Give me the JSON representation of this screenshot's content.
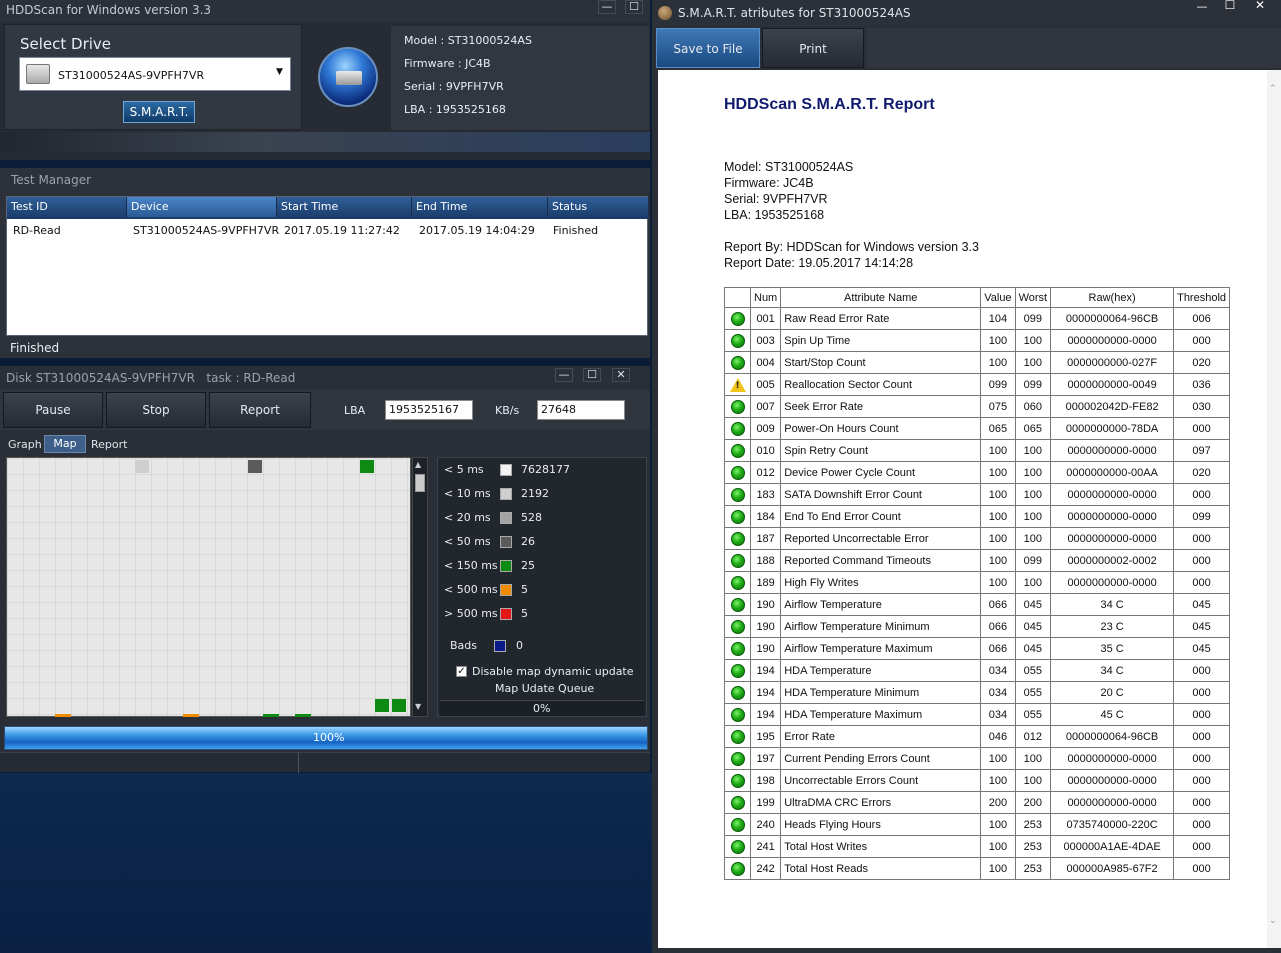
{
  "main_window": {
    "title": "HDDScan for Windows version 3.3",
    "select_drive_label": "Select Drive",
    "drive": "ST31000524AS-9VPFH7VR",
    "smart_button": "S.M.A.R.T.",
    "info": {
      "model": "Model : ST31000524AS",
      "firmware": "Firmware : JC4B",
      "serial": "Serial : 9VPFH7VR",
      "lba": "LBA : 1953525168"
    }
  },
  "test_manager": {
    "title": "Test Manager",
    "columns": [
      "Test ID",
      "Device",
      "Start Time",
      "End Time",
      "Status"
    ],
    "rows": [
      [
        "RD-Read",
        "ST31000524AS-9VPFH7VR",
        "2017.05.19 11:27:42",
        "2017.05.19 14:04:29",
        "Finished"
      ]
    ],
    "status": "Finished"
  },
  "task_window": {
    "title": "Disk ST31000524AS-9VPFH7VR   task : RD-Read",
    "buttons": [
      "Pause",
      "Stop",
      "Report"
    ],
    "lba_label": "LBA",
    "lba_value": "1953525167",
    "kbs_label": "KB/s",
    "kbs_value": "27648",
    "tabs": [
      "Graph",
      "Map",
      "Report"
    ],
    "active_tab": "Map",
    "legend": [
      {
        "label": "< 5 ms",
        "color": "#f2f2f2",
        "value": "7628177"
      },
      {
        "label": "< 10 ms",
        "color": "#cfcfcf",
        "value": "2192"
      },
      {
        "label": "< 20 ms",
        "color": "#a3a3a3",
        "value": "528"
      },
      {
        "label": "< 50 ms",
        "color": "#5b5b5b",
        "value": "26"
      },
      {
        "label": "< 150 ms",
        "color": "#0c8a12",
        "value": "25"
      },
      {
        "label": "< 500 ms",
        "color": "#f08a00",
        "value": "5"
      },
      {
        "label": "> 500 ms",
        "color": "#e61616",
        "value": "5"
      }
    ],
    "bads": {
      "label": "Bads",
      "color": "#0a1a88",
      "value": "0"
    },
    "disable_map": "Disable map dynamic update",
    "map_queue": "Map Udate Queue",
    "queue_percent": "0%",
    "progress": "100%",
    "progress_value": 1.0
  },
  "smart_window": {
    "title": "S.M.A.R.T. atributes for ST31000524AS",
    "save_button": "Save to File",
    "print_button": "Print",
    "report_title": "HDDScan S.M.A.R.T. Report",
    "model": "Model: ST31000524AS",
    "firmware": "Firmware: JC4B",
    "serial": "Serial: 9VPFH7VR",
    "lba": "LBA: 1953525168",
    "report_by": "Report By: HDDScan for Windows version 3.3",
    "report_date": "Report Date: 19.05.2017 14:14:28",
    "columns": [
      "Num",
      "Attribute Name",
      "Value",
      "Worst",
      "Raw(hex)",
      "Threshold"
    ],
    "rows": [
      {
        "status": "ok",
        "num": "001",
        "name": "Raw Read Error Rate",
        "value": "104",
        "worst": "099",
        "raw": "0000000064-96CB",
        "threshold": "006"
      },
      {
        "status": "ok",
        "num": "003",
        "name": "Spin Up Time",
        "value": "100",
        "worst": "100",
        "raw": "0000000000-0000",
        "threshold": "000"
      },
      {
        "status": "ok",
        "num": "004",
        "name": "Start/Stop Count",
        "value": "100",
        "worst": "100",
        "raw": "0000000000-027F",
        "threshold": "020"
      },
      {
        "status": "warn",
        "num": "005",
        "name": "Reallocation Sector Count",
        "value": "099",
        "worst": "099",
        "raw": "0000000000-0049",
        "threshold": "036"
      },
      {
        "status": "ok",
        "num": "007",
        "name": "Seek Error Rate",
        "value": "075",
        "worst": "060",
        "raw": "000002042D-FE82",
        "threshold": "030"
      },
      {
        "status": "ok",
        "num": "009",
        "name": "Power-On Hours Count",
        "value": "065",
        "worst": "065",
        "raw": "0000000000-78DA",
        "threshold": "000"
      },
      {
        "status": "ok",
        "num": "010",
        "name": "Spin Retry Count",
        "value": "100",
        "worst": "100",
        "raw": "0000000000-0000",
        "threshold": "097"
      },
      {
        "status": "ok",
        "num": "012",
        "name": "Device Power Cycle Count",
        "value": "100",
        "worst": "100",
        "raw": "0000000000-00AA",
        "threshold": "020"
      },
      {
        "status": "ok",
        "num": "183",
        "name": "SATA Downshift Error Count",
        "value": "100",
        "worst": "100",
        "raw": "0000000000-0000",
        "threshold": "000"
      },
      {
        "status": "ok",
        "num": "184",
        "name": "End To End Error Count",
        "value": "100",
        "worst": "100",
        "raw": "0000000000-0000",
        "threshold": "099"
      },
      {
        "status": "ok",
        "num": "187",
        "name": "Reported Uncorrectable Error",
        "value": "100",
        "worst": "100",
        "raw": "0000000000-0000",
        "threshold": "000"
      },
      {
        "status": "ok",
        "num": "188",
        "name": "Reported Command Timeouts",
        "value": "100",
        "worst": "099",
        "raw": "0000000002-0002",
        "threshold": "000"
      },
      {
        "status": "ok",
        "num": "189",
        "name": "High Fly Writes",
        "value": "100",
        "worst": "100",
        "raw": "0000000000-0000",
        "threshold": "000"
      },
      {
        "status": "ok",
        "num": "190",
        "name": "Airflow Temperature",
        "value": "066",
        "worst": "045",
        "raw": "34 C",
        "threshold": "045"
      },
      {
        "status": "ok",
        "num": "190",
        "name": "Airflow Temperature Minimum",
        "value": "066",
        "worst": "045",
        "raw": "23 C",
        "threshold": "045"
      },
      {
        "status": "ok",
        "num": "190",
        "name": "Airflow Temperature Maximum",
        "value": "066",
        "worst": "045",
        "raw": "35 C",
        "threshold": "045"
      },
      {
        "status": "ok",
        "num": "194",
        "name": "HDA Temperature",
        "value": "034",
        "worst": "055",
        "raw": "34 C",
        "threshold": "000"
      },
      {
        "status": "ok",
        "num": "194",
        "name": "HDA Temperature Minimum",
        "value": "034",
        "worst": "055",
        "raw": "20 C",
        "threshold": "000"
      },
      {
        "status": "ok",
        "num": "194",
        "name": "HDA Temperature Maximum",
        "value": "034",
        "worst": "055",
        "raw": "45 C",
        "threshold": "000"
      },
      {
        "status": "ok",
        "num": "195",
        "name": "Error Rate",
        "value": "046",
        "worst": "012",
        "raw": "0000000064-96CB",
        "threshold": "000"
      },
      {
        "status": "ok",
        "num": "197",
        "name": "Current Pending Errors Count",
        "value": "100",
        "worst": "100",
        "raw": "0000000000-0000",
        "threshold": "000"
      },
      {
        "status": "ok",
        "num": "198",
        "name": "Uncorrectable Errors Count",
        "value": "100",
        "worst": "100",
        "raw": "0000000000-0000",
        "threshold": "000"
      },
      {
        "status": "ok",
        "num": "199",
        "name": "UltraDMA CRC Errors",
        "value": "200",
        "worst": "200",
        "raw": "0000000000-0000",
        "threshold": "000"
      },
      {
        "status": "ok",
        "num": "240",
        "name": "Heads Flying Hours",
        "value": "100",
        "worst": "253",
        "raw": "0735740000-220C",
        "threshold": "000"
      },
      {
        "status": "ok",
        "num": "241",
        "name": "Total Host Writes",
        "value": "100",
        "worst": "253",
        "raw": "000000A1AE-4DAE",
        "threshold": "000"
      },
      {
        "status": "ok",
        "num": "242",
        "name": "Total Host Reads",
        "value": "100",
        "worst": "253",
        "raw": "000000A985-67F2",
        "threshold": "000"
      }
    ]
  }
}
